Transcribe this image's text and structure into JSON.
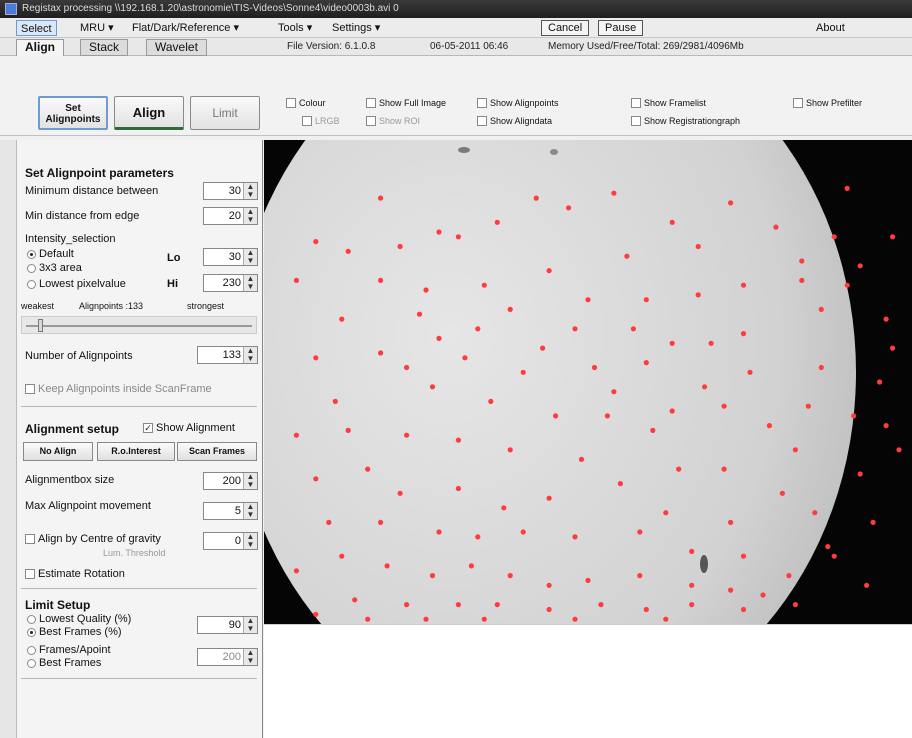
{
  "title": "Registax processing \\\\192.168.1.20\\astronomie\\TIS-Videos\\Sonne4\\video0003b.avi 0",
  "menu": {
    "select": "Select",
    "mru": "MRU",
    "flat": "Flat/Dark/Reference",
    "tools": "Tools",
    "settings": "Settings",
    "cancel": "Cancel",
    "pause": "Pause",
    "about": "About"
  },
  "tabs": [
    "Align",
    "Stack",
    "Wavelet"
  ],
  "info": {
    "version": "File Version: 6.1.0.8",
    "datetime": "06-05-2011 06:46",
    "memory": "Memory Used/Free/Total: 269/2981/4096Mb"
  },
  "toolbar": {
    "set_alignpoints": "Set Alignpoints",
    "align": "Align",
    "limit": "Limit",
    "checks": {
      "colour": "Colour",
      "lrgb": "LRGB",
      "show_full_image": "Show Full Image",
      "show_roi": "Show ROI",
      "show_alignpoints": "Show Alignpoints",
      "show_aligndata": "Show Aligndata",
      "show_framelist": "Show Framelist",
      "show_registrationgraph": "Show Registrationgraph",
      "show_prefilter": "Show Prefilter"
    }
  },
  "panel": {
    "set_params_header": "Set Alignpoint parameters",
    "min_distance_between": {
      "label": "Minimum distance between",
      "value": "30"
    },
    "min_distance_edge": {
      "label": "Min distance from edge",
      "value": "20"
    },
    "intensity_selection": "Intensity_selection",
    "radio_default": "Default",
    "radio_3x3": "3x3 area",
    "radio_lowest": "Lowest pixelvalue",
    "lo": {
      "label": "Lo",
      "value": "30"
    },
    "hi": {
      "label": "Hi",
      "value": "230"
    },
    "weakest": "weakest",
    "alignpoints_count_label": "Alignpoints :133",
    "strongest": "strongest",
    "number_alignpoints": {
      "label": "Number of Alignpoints",
      "value": "133"
    },
    "keep_inside": "Keep Alignpoints inside ScanFrame",
    "alignment_setup": "Alignment setup",
    "show_alignment": "Show Alignment",
    "no_align": "No Align",
    "roi": "R.o.Interest",
    "scan_frames": "Scan Frames",
    "alignmentbox_size": {
      "label": "Alignmentbox size",
      "value": "200"
    },
    "max_movement": {
      "label": "Max Alignpoint movement",
      "value": "5"
    },
    "align_cog": {
      "label": "Align by Centre of gravity",
      "value": "0"
    },
    "lum_threshold": "Lum. Threshold",
    "estimate_rotation": "Estimate Rotation",
    "limit_setup": "Limit Setup",
    "lowest_quality": "Lowest Quality (%)",
    "best_frames_pct": "Best Frames (%)",
    "limit_value_1": "90",
    "frames_apoint": "Frames/Apoint",
    "best_frames": "Best Frames",
    "limit_value_2": "200"
  },
  "colors": {
    "alignpoint": "#ff3b3b",
    "accent": "#6f9bd1"
  },
  "alignpoints": [
    [
      0.18,
      0.12
    ],
    [
      0.27,
      0.19
    ],
    [
      0.36,
      0.17
    ],
    [
      0.42,
      0.12
    ],
    [
      0.47,
      0.14
    ],
    [
      0.54,
      0.11
    ],
    [
      0.63,
      0.17
    ],
    [
      0.72,
      0.13
    ],
    [
      0.79,
      0.18
    ],
    [
      0.9,
      0.1
    ],
    [
      0.08,
      0.21
    ],
    [
      0.13,
      0.23
    ],
    [
      0.21,
      0.22
    ],
    [
      0.3,
      0.2
    ],
    [
      0.56,
      0.24
    ],
    [
      0.67,
      0.22
    ],
    [
      0.83,
      0.25
    ],
    [
      0.05,
      0.29
    ],
    [
      0.18,
      0.29
    ],
    [
      0.25,
      0.31
    ],
    [
      0.34,
      0.3
    ],
    [
      0.44,
      0.27
    ],
    [
      0.59,
      0.33
    ],
    [
      0.67,
      0.32
    ],
    [
      0.74,
      0.3
    ],
    [
      0.83,
      0.29
    ],
    [
      0.92,
      0.26
    ],
    [
      0.12,
      0.37
    ],
    [
      0.24,
      0.36
    ],
    [
      0.33,
      0.39
    ],
    [
      0.38,
      0.35
    ],
    [
      0.5,
      0.33
    ],
    [
      0.57,
      0.39
    ],
    [
      0.69,
      0.42
    ],
    [
      0.74,
      0.4
    ],
    [
      0.86,
      0.35
    ],
    [
      0.96,
      0.37
    ],
    [
      0.08,
      0.45
    ],
    [
      0.18,
      0.44
    ],
    [
      0.27,
      0.41
    ],
    [
      0.43,
      0.43
    ],
    [
      0.51,
      0.47
    ],
    [
      0.59,
      0.46
    ],
    [
      0.68,
      0.51
    ],
    [
      0.75,
      0.48
    ],
    [
      0.86,
      0.47
    ],
    [
      0.97,
      0.43
    ],
    [
      0.11,
      0.54
    ],
    [
      0.26,
      0.51
    ],
    [
      0.35,
      0.54
    ],
    [
      0.45,
      0.57
    ],
    [
      0.53,
      0.57
    ],
    [
      0.63,
      0.56
    ],
    [
      0.71,
      0.55
    ],
    [
      0.78,
      0.59
    ],
    [
      0.84,
      0.55
    ],
    [
      0.95,
      0.5
    ],
    [
      0.05,
      0.61
    ],
    [
      0.13,
      0.6
    ],
    [
      0.22,
      0.61
    ],
    [
      0.3,
      0.62
    ],
    [
      0.38,
      0.64
    ],
    [
      0.49,
      0.66
    ],
    [
      0.6,
      0.6
    ],
    [
      0.64,
      0.68
    ],
    [
      0.71,
      0.68
    ],
    [
      0.82,
      0.64
    ],
    [
      0.91,
      0.57
    ],
    [
      0.08,
      0.7
    ],
    [
      0.16,
      0.68
    ],
    [
      0.21,
      0.73
    ],
    [
      0.3,
      0.72
    ],
    [
      0.37,
      0.76
    ],
    [
      0.44,
      0.74
    ],
    [
      0.55,
      0.71
    ],
    [
      0.62,
      0.77
    ],
    [
      0.72,
      0.79
    ],
    [
      0.8,
      0.73
    ],
    [
      0.92,
      0.69
    ],
    [
      0.1,
      0.79
    ],
    [
      0.18,
      0.79
    ],
    [
      0.27,
      0.81
    ],
    [
      0.33,
      0.82
    ],
    [
      0.4,
      0.81
    ],
    [
      0.48,
      0.82
    ],
    [
      0.58,
      0.81
    ],
    [
      0.66,
      0.85
    ],
    [
      0.74,
      0.86
    ],
    [
      0.85,
      0.77
    ],
    [
      0.94,
      0.79
    ],
    [
      0.05,
      0.89
    ],
    [
      0.12,
      0.86
    ],
    [
      0.19,
      0.88
    ],
    [
      0.26,
      0.9
    ],
    [
      0.32,
      0.88
    ],
    [
      0.38,
      0.9
    ],
    [
      0.44,
      0.92
    ],
    [
      0.5,
      0.91
    ],
    [
      0.58,
      0.9
    ],
    [
      0.66,
      0.92
    ],
    [
      0.72,
      0.93
    ],
    [
      0.81,
      0.9
    ],
    [
      0.88,
      0.86
    ],
    [
      0.14,
      0.95
    ],
    [
      0.22,
      0.96
    ],
    [
      0.3,
      0.96
    ],
    [
      0.36,
      0.96
    ],
    [
      0.44,
      0.97
    ],
    [
      0.52,
      0.96
    ],
    [
      0.59,
      0.97
    ],
    [
      0.66,
      0.96
    ],
    [
      0.74,
      0.97
    ],
    [
      0.82,
      0.96
    ],
    [
      0.08,
      0.98
    ],
    [
      0.16,
      0.99
    ],
    [
      0.25,
      0.99
    ],
    [
      0.34,
      0.99
    ],
    [
      0.48,
      0.99
    ],
    [
      0.62,
      0.99
    ],
    [
      0.77,
      0.94
    ],
    [
      0.87,
      0.84
    ],
    [
      0.93,
      0.92
    ],
    [
      0.96,
      0.59
    ],
    [
      0.98,
      0.64
    ],
    [
      0.9,
      0.3
    ],
    [
      0.88,
      0.2
    ],
    [
      0.97,
      0.2
    ],
    [
      0.54,
      0.52
    ],
    [
      0.4,
      0.48
    ],
    [
      0.31,
      0.45
    ],
    [
      0.22,
      0.47
    ],
    [
      0.48,
      0.39
    ],
    [
      0.63,
      0.42
    ]
  ]
}
